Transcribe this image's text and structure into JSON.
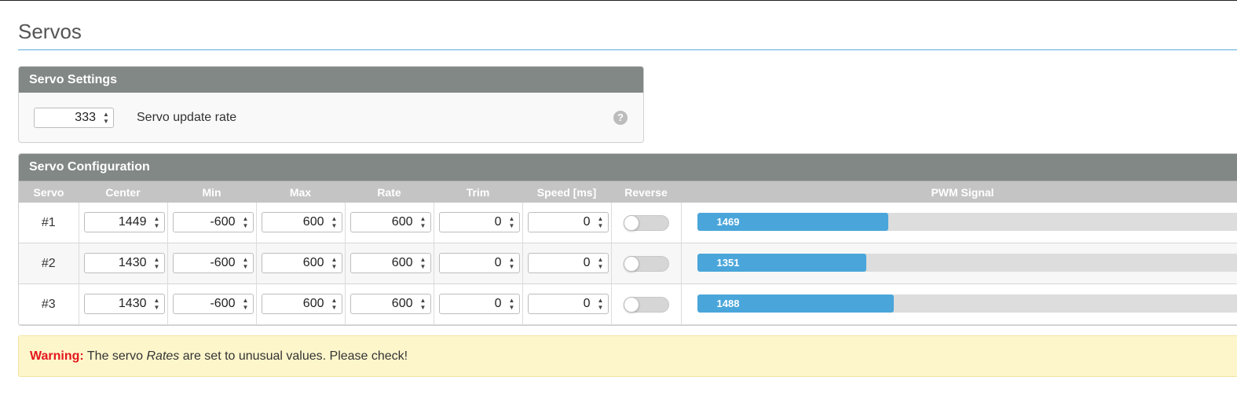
{
  "page": {
    "title": "Servos",
    "accent_color": "#59aadc"
  },
  "servo_settings": {
    "header": "Servo Settings",
    "update_rate_value": "333",
    "update_rate_label": "Servo update rate",
    "help_icon": "question-circle-icon",
    "help_glyph": "?"
  },
  "servo_configuration": {
    "header": "Servo Configuration",
    "columns": {
      "servo": "Servo",
      "center": "Center",
      "min": "Min",
      "max": "Max",
      "rate": "Rate",
      "trim": "Trim",
      "speed": "Speed [ms]",
      "reverse": "Reverse",
      "pwm": "PWM Signal"
    },
    "pwm_range": [
      1000,
      2000
    ],
    "pwm_color": "#4aa6da",
    "rows": [
      {
        "id": "#1",
        "center": "1449",
        "min": "-600",
        "max": "600",
        "rate": "600",
        "trim": "0",
        "speed": "0",
        "reverse": false,
        "pwm": "1469",
        "pwm_fraction": 0.35
      },
      {
        "id": "#2",
        "center": "1430",
        "min": "-600",
        "max": "600",
        "rate": "600",
        "trim": "0",
        "speed": "0",
        "reverse": false,
        "pwm": "1351",
        "pwm_fraction": 0.31
      },
      {
        "id": "#3",
        "center": "1430",
        "min": "-600",
        "max": "600",
        "rate": "600",
        "trim": "0",
        "speed": "0",
        "reverse": false,
        "pwm": "1488",
        "pwm_fraction": 0.36
      }
    ]
  },
  "warning": {
    "label": "Warning:",
    "text_before": "The servo",
    "emphasis": "Rates",
    "text_after": "are set to unusual values. Please check!",
    "background": "#fdf6cb",
    "label_color": "#e4161e"
  }
}
